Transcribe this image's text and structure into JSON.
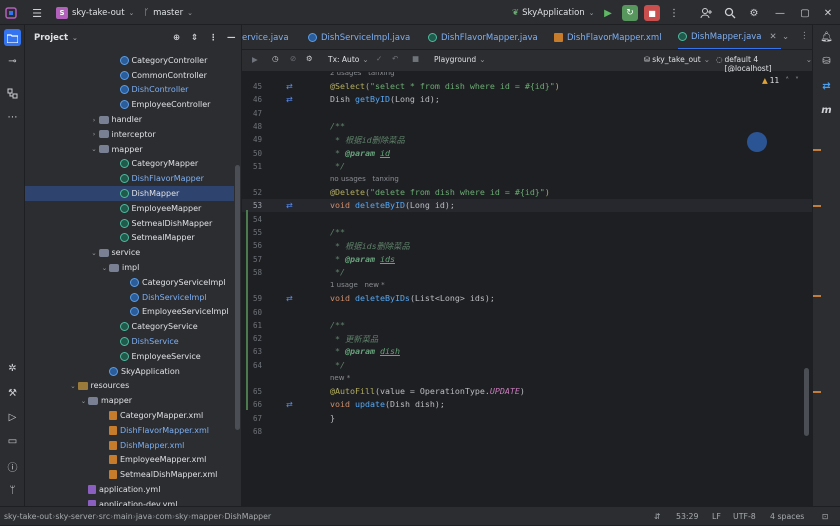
{
  "topbar": {
    "project_initials": "S",
    "project_name": "sky-take-out",
    "branch": "master",
    "run_config": "SkyApplication"
  },
  "project_panel": {
    "title": "Project",
    "tree": [
      {
        "label": "CategoryController",
        "icon": "class",
        "indent": 9,
        "color": "#dfe1e5"
      },
      {
        "label": "CommonController",
        "icon": "class",
        "indent": 9,
        "color": "#dfe1e5"
      },
      {
        "label": "DishController",
        "icon": "class",
        "indent": 9,
        "color": "#7eb0f5"
      },
      {
        "label": "EmployeeController",
        "icon": "class",
        "indent": 9,
        "color": "#dfe1e5"
      },
      {
        "label": "handler",
        "icon": "folder",
        "indent": 7,
        "caret": "›",
        "color": "#dfe1e5"
      },
      {
        "label": "interceptor",
        "icon": "folder",
        "indent": 7,
        "caret": "›",
        "color": "#dfe1e5"
      },
      {
        "label": "mapper",
        "icon": "folder",
        "indent": 7,
        "caret": "⌄",
        "color": "#dfe1e5"
      },
      {
        "label": "CategoryMapper",
        "icon": "interface",
        "indent": 9,
        "color": "#dfe1e5"
      },
      {
        "label": "DishFlavorMapper",
        "icon": "interface",
        "indent": 9,
        "color": "#7eb0f5"
      },
      {
        "label": "DishMapper",
        "icon": "interface",
        "indent": 9,
        "color": "#dfe1e5",
        "selected": true
      },
      {
        "label": "EmployeeMapper",
        "icon": "interface",
        "indent": 9,
        "color": "#dfe1e5"
      },
      {
        "label": "SetmealDishMapper",
        "icon": "interface",
        "indent": 9,
        "color": "#dfe1e5"
      },
      {
        "label": "SetmealMapper",
        "icon": "interface",
        "indent": 9,
        "color": "#dfe1e5"
      },
      {
        "label": "service",
        "icon": "folder",
        "indent": 7,
        "caret": "⌄",
        "color": "#dfe1e5"
      },
      {
        "label": "impl",
        "icon": "folder",
        "indent": 8,
        "caret": "⌄",
        "color": "#dfe1e5"
      },
      {
        "label": "CategoryServiceImpl",
        "icon": "class",
        "indent": 10,
        "color": "#dfe1e5"
      },
      {
        "label": "DishServiceImpl",
        "icon": "class",
        "indent": 10,
        "color": "#7eb0f5"
      },
      {
        "label": "EmployeeServiceImpl",
        "icon": "class",
        "indent": 10,
        "color": "#dfe1e5"
      },
      {
        "label": "CategoryService",
        "icon": "interface",
        "indent": 9,
        "color": "#dfe1e5"
      },
      {
        "label": "DishService",
        "icon": "interface",
        "indent": 9,
        "color": "#7eb0f5"
      },
      {
        "label": "EmployeeService",
        "icon": "interface",
        "indent": 9,
        "color": "#dfe1e5"
      },
      {
        "label": "SkyApplication",
        "icon": "class",
        "indent": 8,
        "color": "#dfe1e5"
      },
      {
        "label": "resources",
        "icon": "resfolder",
        "indent": 5,
        "caret": "⌄",
        "color": "#dfe1e5"
      },
      {
        "label": "mapper",
        "icon": "folder",
        "indent": 6,
        "caret": "⌄",
        "color": "#dfe1e5"
      },
      {
        "label": "CategoryMapper.xml",
        "icon": "xml",
        "indent": 8,
        "color": "#dfe1e5"
      },
      {
        "label": "DishFlavorMapper.xml",
        "icon": "xml",
        "indent": 8,
        "color": "#7eb0f5"
      },
      {
        "label": "DishMapper.xml",
        "icon": "xml",
        "indent": 8,
        "color": "#7eb0f5"
      },
      {
        "label": "EmployeeMapper.xml",
        "icon": "xml",
        "indent": 8,
        "color": "#dfe1e5"
      },
      {
        "label": "SetmealDishMapper.xml",
        "icon": "xml",
        "indent": 8,
        "color": "#dfe1e5"
      },
      {
        "label": "application.yml",
        "icon": "yml",
        "indent": 6,
        "color": "#dfe1e5"
      },
      {
        "label": "application-dev.yml",
        "icon": "yml",
        "indent": 6,
        "color": "#dfe1e5"
      }
    ]
  },
  "tabs": [
    {
      "label": "ervice.java",
      "active": false
    },
    {
      "label": "DishServiceImpl.java",
      "active": false
    },
    {
      "label": "DishFlavorMapper.java",
      "active": false
    },
    {
      "label": "DishFlavorMapper.xml",
      "active": false
    },
    {
      "label": "DishMapper.java",
      "active": true
    }
  ],
  "editor_toolbar": {
    "tx_mode": "Tx: Auto",
    "playground": "Playground",
    "datasource": "sky_take_out",
    "session": "default 4 [@localhost]",
    "warnings": "11"
  },
  "editor": {
    "top_hint": "2 usages   tanxing",
    "lines": [
      {
        "n": "45",
        "html": "<span class='ann'>@Select(</span><span class='str'>\"select * from dish where id = #{id}\"</span><span class='ann'>)</span>",
        "mark": true
      },
      {
        "n": "46",
        "html": "Dish <span class='fn'>getByID</span>(Long id);",
        "mark": true
      },
      {
        "n": "47",
        "html": ""
      },
      {
        "n": "48",
        "html": "<span class='doc'>/**</span>"
      },
      {
        "n": "49",
        "html": "<span class='doc'> * 根据id删除菜品</span>"
      },
      {
        "n": "50",
        "html": "<span class='doc'> * </span><span class='tag'>@param</span> <span class='prm'>id</span>"
      },
      {
        "n": "51",
        "html": "<span class='doc'> */</span>"
      },
      {
        "hint": "no usages   tanxing"
      },
      {
        "n": "52",
        "html": "<span class='ann'>@Delete(</span><span class='str'>\"delete from dish where id = #{id}\"</span><span class='ann'>)</span>"
      },
      {
        "n": "53",
        "html": "<span class='kw'>void</span> <span class='fn'>deleteByID</span>(Long id);",
        "mark": true,
        "current": true
      },
      {
        "n": "54",
        "html": ""
      },
      {
        "n": "55",
        "html": "<span class='doc'>/**</span>"
      },
      {
        "n": "56",
        "html": "<span class='doc'> * 根据ids删除菜品</span>"
      },
      {
        "n": "57",
        "html": "<span class='doc'> * </span><span class='tag'>@param</span> <span class='prm'>ids</span>"
      },
      {
        "n": "58",
        "html": "<span class='doc'> */</span>"
      },
      {
        "hint": "1 usage   new *"
      },
      {
        "n": "59",
        "html": "<span class='kw'>void</span> <span class='fn'>deleteByIDs</span>(List&lt;Long&gt; ids);",
        "mark": true
      },
      {
        "n": "60",
        "html": ""
      },
      {
        "n": "61",
        "html": "<span class='doc'>/**</span>"
      },
      {
        "n": "62",
        "html": "<span class='doc'> * 更新菜品</span>"
      },
      {
        "n": "63",
        "html": "<span class='doc'> * </span><span class='tag'>@param</span> <span class='prm'>dish</span>"
      },
      {
        "n": "64",
        "html": "<span class='doc'> */</span>"
      },
      {
        "hint": "new *"
      },
      {
        "n": "65",
        "html": "<span class='ann'>@AutoFill</span>(value = OperationType.<span class='it'>UPDATE</span>)"
      },
      {
        "n": "66",
        "html": "<span class='kw'>void</span> <span class='fn'>update</span>(Dish dish);",
        "mark": true
      },
      {
        "n": "67",
        "html": "}"
      },
      {
        "n": "68",
        "html": ""
      }
    ]
  },
  "statusbar": {
    "crumbs": [
      "sky-take-out",
      "sky-server",
      "src",
      "main",
      "java",
      "com",
      "sky",
      "mapper",
      "DishMapper"
    ],
    "position": "53:29",
    "line_sep": "LF",
    "encoding": "UTF-8",
    "indent": "4 spaces"
  }
}
